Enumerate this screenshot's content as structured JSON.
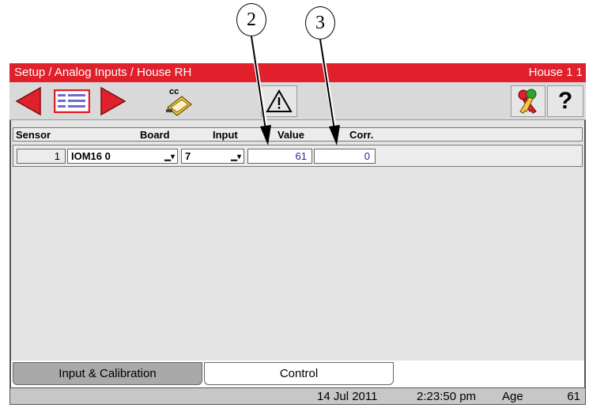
{
  "callouts": [
    "2",
    "3"
  ],
  "titlebar": {
    "title": "Setup / Analog Inputs / House RH",
    "house": "House 1 1"
  },
  "toolbar": {
    "buttons": [
      "previous-page",
      "menu",
      "next-page",
      "copy-config",
      "alarm",
      "access-keys",
      "help"
    ],
    "cc_label": "cc",
    "help_label": "?"
  },
  "table": {
    "headers": {
      "sensor": "Sensor",
      "board": "Board",
      "input": "Input",
      "value": "Value",
      "corr": "Corr."
    },
    "rows": [
      {
        "sensor": "1",
        "board": "IOM16 0",
        "input": "7",
        "value": "61",
        "corr": "0"
      }
    ]
  },
  "tabs": [
    {
      "label": "Input & Calibration",
      "active": true
    },
    {
      "label": "Control",
      "active": false
    }
  ],
  "status": {
    "date": "14 Jul 2011",
    "time": "2:23:50 pm",
    "age_label": "Age",
    "age_value": "61"
  },
  "colors": {
    "titlebar": "#e0202b",
    "arrow_red": "#e0202b",
    "value_text": "#1f2d8a"
  }
}
